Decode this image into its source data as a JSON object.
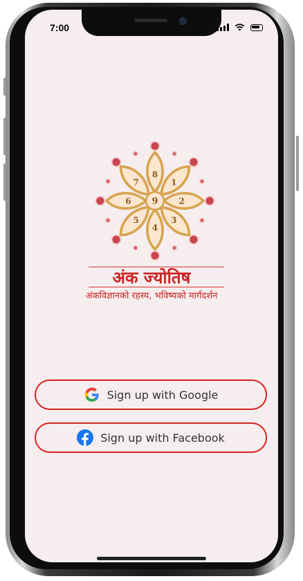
{
  "status_bar": {
    "time": "7:00"
  },
  "app": {
    "title": "अंक ज्योतिष",
    "tagline": "अंकविज्ञानको रहस्य, भविष्यको मार्गदर्शन"
  },
  "logo": {
    "petal_numbers": [
      "8",
      "1",
      "2",
      "3",
      "4",
      "5",
      "6",
      "7"
    ],
    "center_number": "9"
  },
  "auth": {
    "google_label": "Sign up with Google",
    "facebook_label": "Sign up with Facebook"
  },
  "colors": {
    "accent": "#d82020",
    "screen_bg": "#f6eeee",
    "petal": "#d7a451"
  },
  "icons": {
    "google": "google-icon",
    "facebook": "facebook-icon"
  }
}
